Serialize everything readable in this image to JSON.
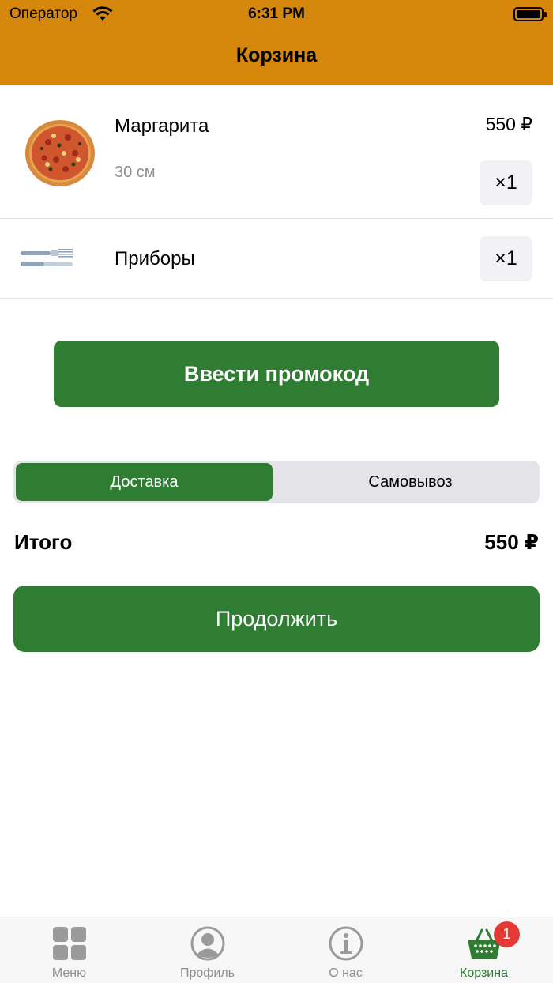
{
  "status_bar": {
    "carrier": "Оператор",
    "time": "6:31 PM"
  },
  "header": {
    "title": "Корзина"
  },
  "cart": {
    "items": [
      {
        "name": "Маргарита",
        "size": "30 см",
        "price": "550 ₽",
        "quantity": "×1",
        "image": "pizza-image"
      },
      {
        "name": "Приборы",
        "quantity": "×1",
        "image": "cutlery-image"
      }
    ],
    "promo_label": "Ввести промокод"
  },
  "delivery_mode": {
    "options": [
      "Доставка",
      "Самовывоз"
    ],
    "selected": "Доставка"
  },
  "total": {
    "label": "Итого",
    "value": "550 ₽"
  },
  "continue_label": "Продолжить",
  "tab_bar": {
    "tabs": [
      {
        "label": "Меню",
        "icon": "grid-icon"
      },
      {
        "label": "Профиль",
        "icon": "profile-icon"
      },
      {
        "label": "О нас",
        "icon": "info-icon"
      },
      {
        "label": "Корзина",
        "icon": "basket-icon"
      }
    ],
    "active": "Корзина",
    "cart_badge": "1"
  },
  "colors": {
    "header": "#d4870a",
    "accent": "#2e7d32",
    "badge": "#e53935",
    "inactive": "#8e8e93"
  }
}
